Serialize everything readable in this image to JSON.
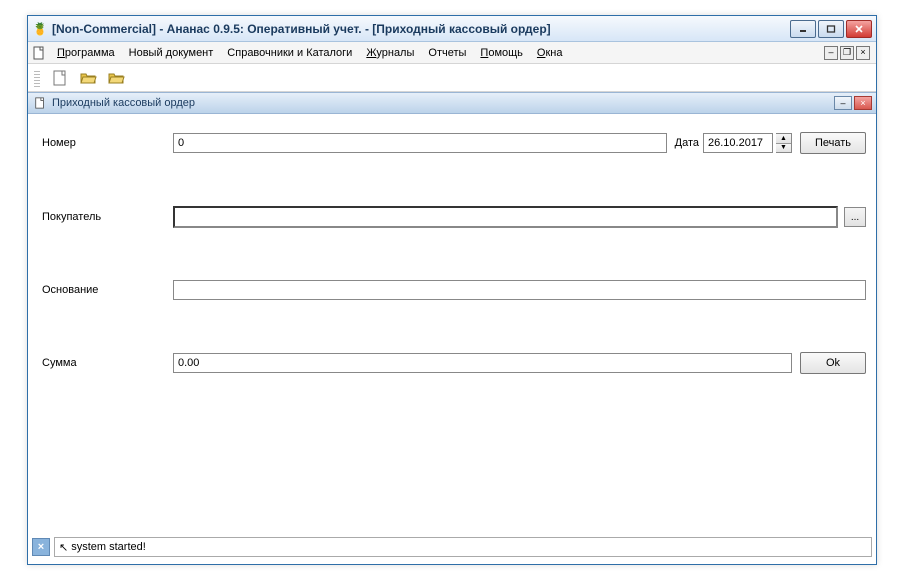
{
  "window": {
    "title": "[Non-Commercial] - Ананас 0.9.5: Оперативный учет. - [Приходный кассовый ордер]"
  },
  "menu": {
    "program": "Программа",
    "new_doc": "Новый документ",
    "catalogs": "Справочники и Каталоги",
    "journals": "Журналы",
    "reports": "Отчеты",
    "help": "Помощь",
    "windows": "Окна"
  },
  "sub": {
    "title": "Приходный кассовый ордер"
  },
  "form": {
    "number_label": "Номер",
    "number_value": "0",
    "date_label": "Дата",
    "date_value": "26.10.2017",
    "print_label": "Печать",
    "buyer_label": "Покупатель",
    "buyer_value": "",
    "browse_label": "...",
    "basis_label": "Основание",
    "basis_value": "",
    "sum_label": "Сумма",
    "sum_value": "0.00",
    "ok_label": "Ok"
  },
  "status": {
    "message": "system started!"
  }
}
